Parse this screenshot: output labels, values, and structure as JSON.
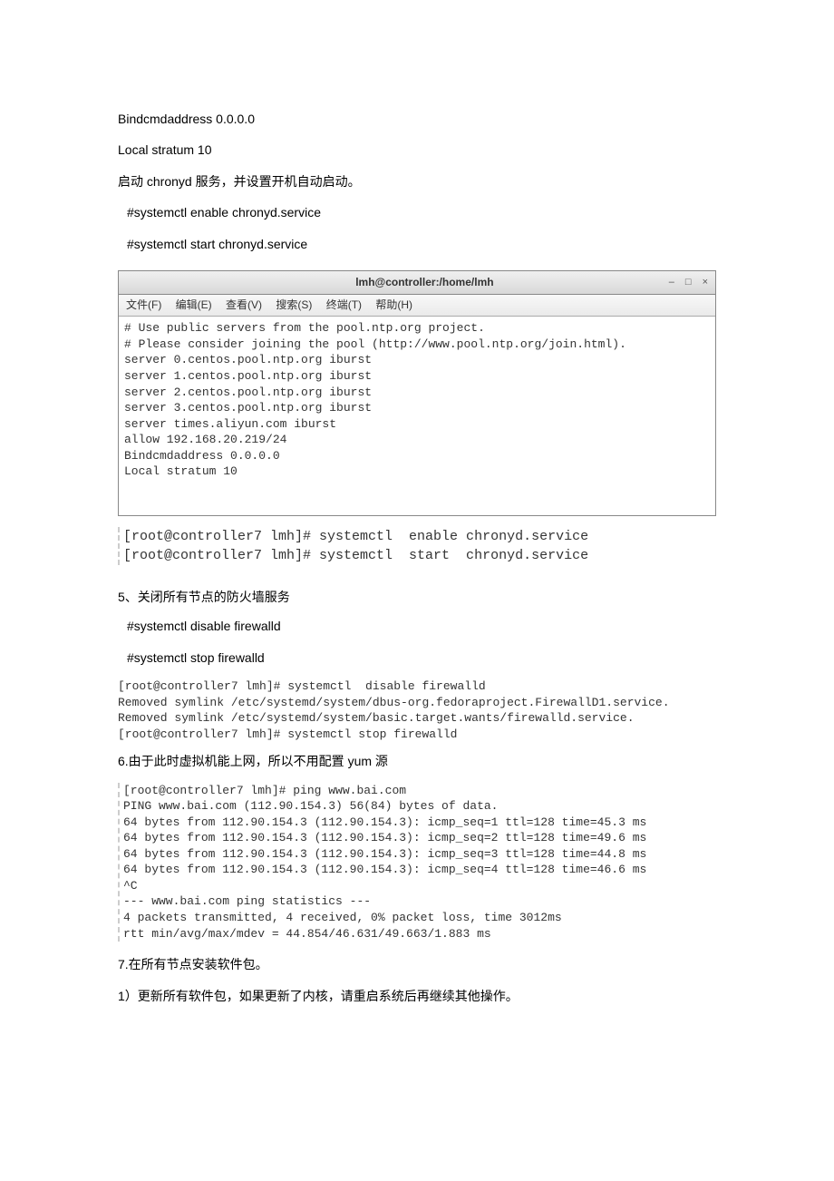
{
  "intro": {
    "line1": "Bindcmdaddress 0.0.0.0",
    "line2": "Local stratum 10",
    "line3": "启动 chronyd 服务，并设置开机自动启动。",
    "cmd1": "#systemctl    enable chronyd.service",
    "cmd2": "#systemctl    start    chronyd.service"
  },
  "terminal": {
    "title": "lmh@controller:/home/lmh",
    "controls": {
      "min": "–",
      "max": "□",
      "close": "×"
    },
    "menus": {
      "file": "文件(F)",
      "edit": "编辑(E)",
      "view": "查看(V)",
      "search": "搜索(S)",
      "term": "终端(T)",
      "help": "帮助(H)"
    },
    "body": "# Use public servers from the pool.ntp.org project.\n# Please consider joining the pool (http://www.pool.ntp.org/join.html).\nserver 0.centos.pool.ntp.org iburst\nserver 1.centos.pool.ntp.org iburst\nserver 2.centos.pool.ntp.org iburst\nserver 3.centos.pool.ntp.org iburst\nserver times.aliyun.com iburst\nallow 192.168.20.219/24\nBindcmdaddress 0.0.0.0\nLocal stratum 10\n\n\n"
  },
  "chronyd_cmds": "[root@controller7 lmh]# systemctl  enable chronyd.service\n[root@controller7 lmh]# systemctl  start  chronyd.service",
  "section5": {
    "heading": "5、关闭所有节点的防火墙服务",
    "cmd1": "#systemctl    disable firewalld",
    "cmd2": "#systemctl stop firewalld",
    "output": "[root@controller7 lmh]# systemctl  disable firewalld\nRemoved symlink /etc/systemd/system/dbus-org.fedoraproject.FirewallD1.service.\nRemoved symlink /etc/systemd/system/basic.target.wants/firewalld.service.\n[root@controller7 lmh]# systemctl stop firewalld"
  },
  "section6": {
    "heading": "6.由于此时虚拟机能上网，所以不用配置 yum 源",
    "output": "[root@controller7 lmh]# ping www.bai.com\nPING www.bai.com (112.90.154.3) 56(84) bytes of data.\n64 bytes from 112.90.154.3 (112.90.154.3): icmp_seq=1 ttl=128 time=45.3 ms\n64 bytes from 112.90.154.3 (112.90.154.3): icmp_seq=2 ttl=128 time=49.6 ms\n64 bytes from 112.90.154.3 (112.90.154.3): icmp_seq=3 ttl=128 time=44.8 ms\n64 bytes from 112.90.154.3 (112.90.154.3): icmp_seq=4 ttl=128 time=46.6 ms\n^C\n--- www.bai.com ping statistics ---\n4 packets transmitted, 4 received, 0% packet loss, time 3012ms\nrtt min/avg/max/mdev = 44.854/46.631/49.663/1.883 ms"
  },
  "section7": {
    "heading": "7.在所有节点安装软件包。",
    "sub1": "1）更新所有软件包，如果更新了内核，请重启系统后再继续其他操作。"
  }
}
